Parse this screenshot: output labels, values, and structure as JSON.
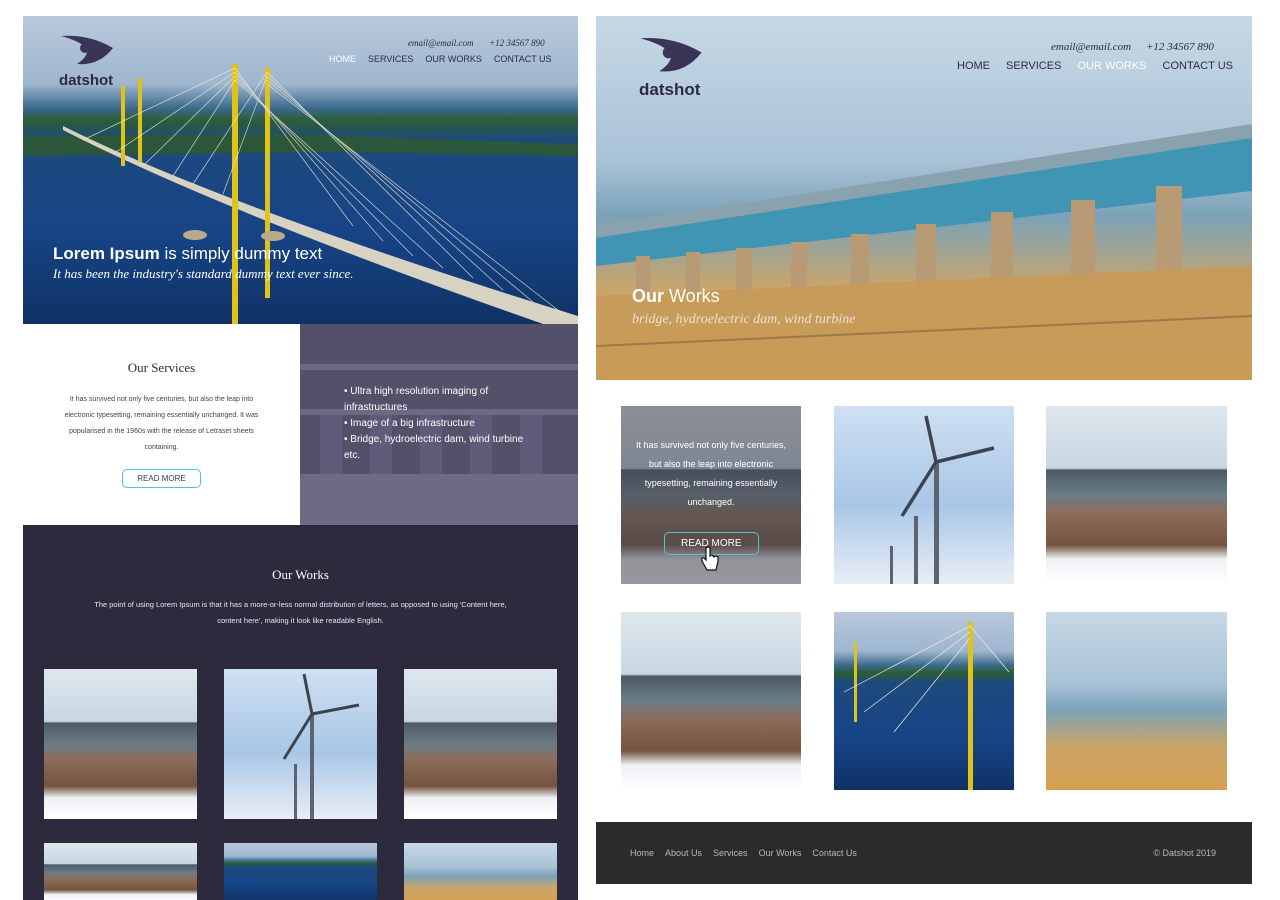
{
  "brand": {
    "name": "datshot",
    "logo_icon": "eye-logo-icon"
  },
  "contact": {
    "email": "email@email.com",
    "phone": "+12 34567 890"
  },
  "nav": [
    "HOME",
    "SERVICES",
    "OUR WORKS",
    "CONTACT US"
  ],
  "left_page": {
    "active_nav": "HOME",
    "hero": {
      "title_bold": "Lorem Ipsum",
      "title_rest": " is simply dummy text",
      "subtitle": "It has been the industry's standard dummy text ever since."
    },
    "services": {
      "title": "Our Services",
      "body": "It has survived not only five centuries, but also the leap into electronic typesetting, remaining essentially unchanged. It was popularised in the 1960s with the release of Letraset sheets containing.",
      "button": "READ MORE",
      "list": [
        "Ultra high resolution imaging of infrastructures",
        "Image of a big infrastructure",
        "Bridge, hydroelectric dam, wind turbine etc."
      ]
    },
    "works": {
      "title": "Our Works",
      "description": "The point of using Lorem Ipsum is that it has a more-or-less normal distribution of letters, as opposed to using 'Content here, content here', making it look like readable English."
    }
  },
  "right_page": {
    "active_nav": "OUR WORKS",
    "hero": {
      "title_bold": "Our",
      "title_rest": " Works",
      "subtitle": "bridge, hydroelectric dam, wind turbine"
    },
    "gallery_overlay": {
      "text": "It has survived not only five centuries, but also the leap into electronic typesetting, remaining essentially unchanged.",
      "button": "READ MORE",
      "cursor_icon": "hand-pointer-icon"
    },
    "footer": {
      "links": [
        "Home",
        "About Us",
        "Services",
        "Our Works",
        "Contact Us"
      ],
      "copyright": "© Datshot 2019"
    }
  },
  "colors": {
    "accent": "#4fc3d6",
    "dark": "#2e2a3e",
    "footer": "#2b2b2b"
  }
}
